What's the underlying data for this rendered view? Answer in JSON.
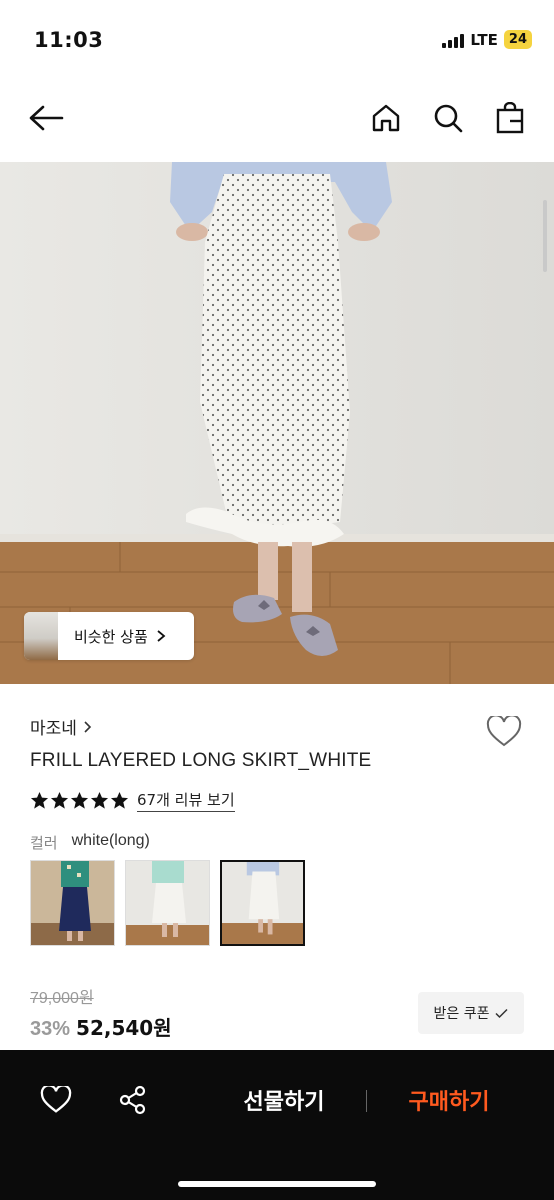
{
  "status_bar": {
    "time": "11:03",
    "network": "LTE",
    "battery": "24"
  },
  "header": {
    "back_icon": "arrow-left-icon",
    "home_icon": "home-icon",
    "search_icon": "search-icon",
    "bag_icon": "shopping-bag-icon"
  },
  "image": {
    "similar_label": "비슷한 상품"
  },
  "product": {
    "brand": "마조네",
    "title": "FRILL LAYERED LONG SKIRT_WHITE",
    "rating_stars": 5,
    "review_link": "67개 리뷰 보기",
    "color_label": "컬러",
    "color_value": "white(long)",
    "swatches": [
      "navy",
      "mint",
      "white"
    ],
    "selected_swatch": "white",
    "original_price": "79,000원",
    "discount": "33%",
    "sale_price": "52,540원",
    "coupon_label": "받은 쿠폰"
  },
  "bottom_bar": {
    "gift_label": "선물하기",
    "buy_label": "구매하기"
  },
  "colors": {
    "buy_accent": "#ff5a1f",
    "bar_bg": "#0b0b0b",
    "battery": "#f5d33f"
  }
}
